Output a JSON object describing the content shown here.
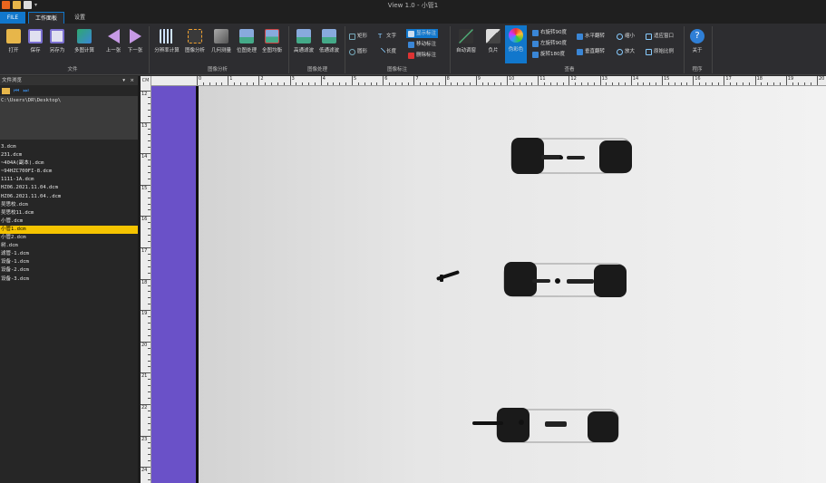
{
  "window": {
    "title": "View 1.0 - 小管1"
  },
  "tabs": [
    {
      "label": "FILE"
    },
    {
      "label": "工作面板"
    },
    {
      "label": "设置"
    }
  ],
  "ribbon": {
    "file": {
      "label": "文件",
      "buttons": [
        "打开",
        "保存",
        "另存为",
        "多图计算",
        "上一张",
        "下一张"
      ]
    },
    "analysis": {
      "label": "图像分析",
      "buttons": [
        "分辨率计算",
        "图像分析",
        "几何测量",
        "位图处理",
        "全图均衡"
      ]
    },
    "processing": {
      "label": "图像处理",
      "buttons": [
        "高通滤波",
        "低通滤波"
      ]
    },
    "annotation": {
      "label": "图像标注",
      "small": [
        "矩形",
        "圆形",
        "文字",
        "长度",
        "显示标注",
        "移动标注",
        "删除标注"
      ]
    },
    "view": {
      "label": "查看",
      "buttons": [
        "自动调窗",
        "负片",
        "伪彩色"
      ],
      "small": [
        "右旋转90度",
        "左旋转90度",
        "旋转180度",
        "水平翻转",
        "垂直翻转",
        "缩小",
        "放大",
        "适应窗口",
        "原始比例"
      ]
    },
    "program": {
      "label": "程序",
      "buttons": [
        "关于"
      ]
    }
  },
  "left_pane": {
    "title": "文件浏览",
    "close": "×",
    "pin": "▾",
    "path": "C:\\Users\\DR\\Desktop\\",
    "files": [
      "3.dcm",
      "231.dcm",
      "~404A(副本).dcm",
      "~94HZC700FI-8.dcm",
      "1111-1A.dcm",
      "HZ06.2021.11.04.dcm",
      "HZ06.2021.11.04..dcm",
      "吴思校.dcm",
      "吴思校11.dcm",
      "小管.dcm",
      "小管1.dcm",
      "小管2.dcm",
      "树.dcm",
      "滤管-1.dcm",
      "设备-1.dcm",
      "设备-2.dcm",
      "设备-3.dcm"
    ],
    "selected_index": 10
  },
  "ruler": {
    "corner": "CM",
    "top": [
      "0",
      "1",
      "2",
      "3",
      "4",
      "5",
      "6",
      "7",
      "8",
      "9",
      "10",
      "11",
      "12",
      "13",
      "14",
      "15",
      "16",
      "17",
      "18",
      "19",
      "20"
    ],
    "left": [
      "12",
      "13",
      "14",
      "15",
      "16",
      "17",
      "18",
      "19",
      "20",
      "21",
      "22",
      "23",
      "24"
    ]
  },
  "colors": {
    "purple": "#6a51c8",
    "accent": "#1177cc",
    "selected_file": "#f5c400"
  }
}
